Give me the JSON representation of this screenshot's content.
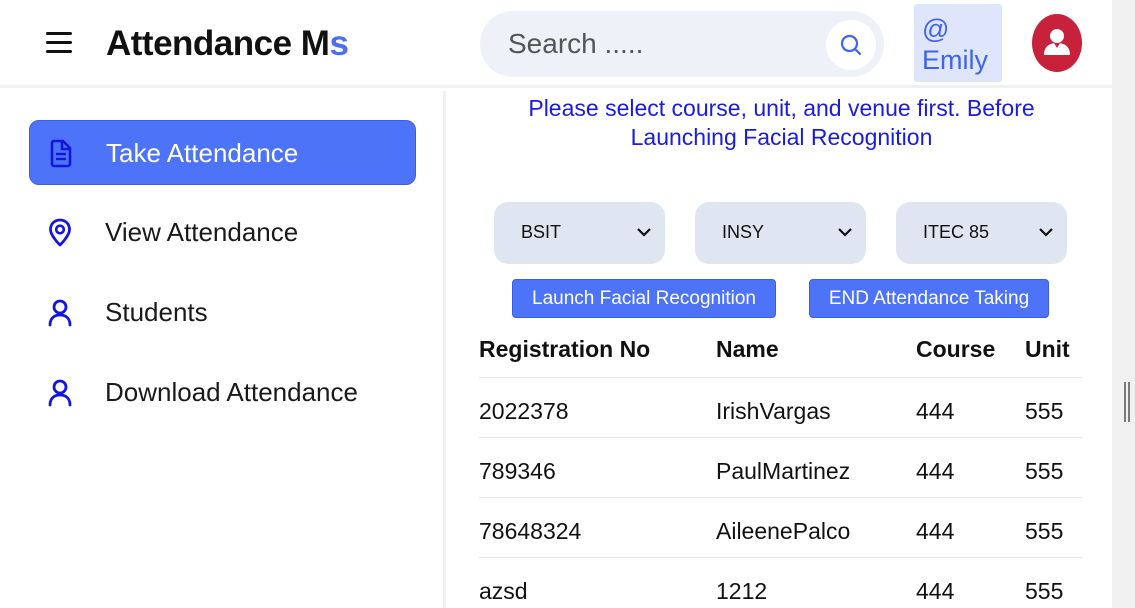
{
  "header": {
    "brand_main": "Attendance M",
    "brand_accent": "s",
    "search_placeholder": "Search .....",
    "user_tag_line1": "@",
    "user_tag_line2": "Emily"
  },
  "sidebar": {
    "items": [
      {
        "label": "Take Attendance",
        "icon": "document-icon",
        "active": true
      },
      {
        "label": "View Attendance",
        "icon": "location-pin-icon",
        "active": false
      },
      {
        "label": "Students",
        "icon": "user-icon",
        "active": false
      },
      {
        "label": "Download Attendance",
        "icon": "user-icon",
        "active": false
      }
    ]
  },
  "main": {
    "notice": "Please select course, unit, and venue first. Before Launching Facial Recognition",
    "selects": [
      {
        "value": "BSIT"
      },
      {
        "value": "INSY"
      },
      {
        "value": "ITEC 85"
      }
    ],
    "buttons": {
      "launch": "Launch Facial Recognition",
      "end": "END Attendance Taking"
    },
    "table": {
      "headers": [
        "Registration No",
        "Name",
        "Course",
        "Unit"
      ],
      "rows": [
        [
          "2022378",
          "IrishVargas",
          "444",
          "555"
        ],
        [
          "789346",
          "PaulMartinez",
          "444",
          "555"
        ],
        [
          "78648324",
          "AileenePalco",
          "444",
          "555"
        ],
        [
          "azsd",
          "1212",
          "444",
          "555"
        ]
      ]
    }
  },
  "colors": {
    "accent": "#4d73f8",
    "notice_text": "#1a1ae6",
    "avatar_bg": "#c8213c",
    "icon_blue": "#1515e0"
  }
}
